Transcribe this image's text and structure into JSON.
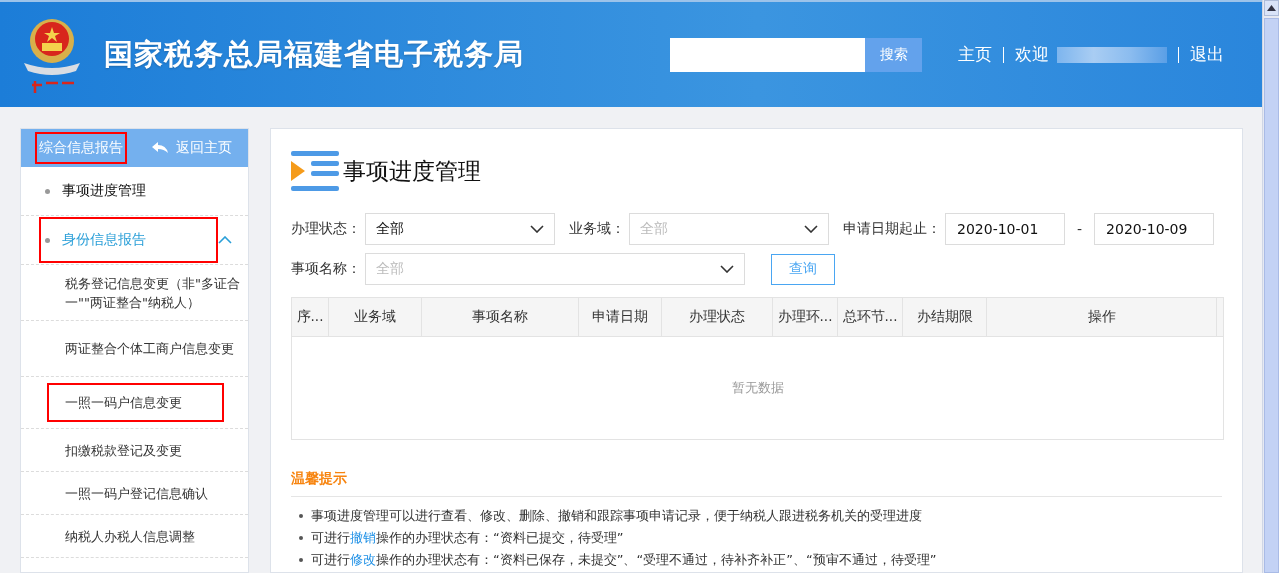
{
  "header": {
    "title": "国家税务总局福建省电子税务局",
    "search": {
      "button": "搜索"
    },
    "links": [
      {
        "label": "主页"
      },
      {
        "label": "欢迎",
        "redacted_name": true
      },
      {
        "label": "退出"
      }
    ]
  },
  "sidebar": {
    "section": {
      "label": "综合信息报告",
      "marked": true
    },
    "back": "返回主页",
    "items": [
      {
        "label": "事项进度管理",
        "expanded": false,
        "marked": false
      },
      {
        "label": "身份信息报告",
        "expanded": true,
        "marked": true,
        "children": [
          {
            "label": "税务登记信息变更（非\"多证合一\"\"两证整合\"纳税人）",
            "marked": false
          },
          {
            "label": "两证整合个体工商户信息变更",
            "marked": false
          },
          {
            "label": "一照一码户信息变更",
            "marked": true
          },
          {
            "label": "扣缴税款登记及变更",
            "marked": false
          },
          {
            "label": "一照一码户登记信息确认",
            "marked": false
          },
          {
            "label": "纳税人办税人信息调整",
            "marked": false
          }
        ]
      }
    ]
  },
  "main": {
    "title": "事项进度管理",
    "filters": {
      "status": {
        "label": "办理状态：",
        "value": "全部"
      },
      "domain": {
        "label": "业务域：",
        "placeholder": "全部"
      },
      "dates": {
        "label": "申请日期起止：",
        "from": "2020-10-01",
        "separator": "-",
        "to": "2020-10-09"
      },
      "item": {
        "label": "事项名称：",
        "placeholder": "全部"
      },
      "query": "查询"
    },
    "table": {
      "columns": [
        "序...",
        "业务域",
        "事项名称",
        "申请日期",
        "办理状态",
        "办理环...",
        "总环节...",
        "办结期限",
        "操作"
      ],
      "empty": "暂无数据"
    },
    "tips": {
      "title": "温馨提示",
      "lines": [
        [
          {
            "kind": "text",
            "text": "事项进度管理可以进行查看、修改、删除、撤销和跟踪事项申请记录，便于纳税人跟进税务机关的受理进度"
          }
        ],
        [
          {
            "kind": "text",
            "text": "可进行"
          },
          {
            "kind": "link",
            "text": "撤销"
          },
          {
            "kind": "text",
            "text": "操作的办理状态有：“资料已提交，待受理”"
          }
        ],
        [
          {
            "kind": "text",
            "text": "可进行"
          },
          {
            "kind": "link",
            "text": "修改"
          },
          {
            "kind": "text",
            "text": "操作的办理状态有：“资料已保存，未提交”、“受理不通过，待补齐补正”、“预审不通过，待受理”"
          }
        ]
      ]
    }
  }
}
